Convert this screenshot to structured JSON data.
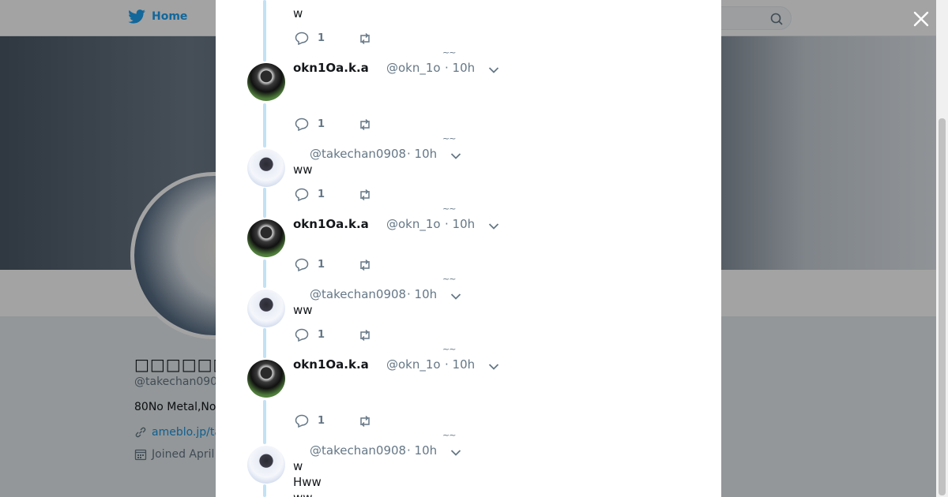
{
  "nav": {
    "home_label": "Home"
  },
  "profile": {
    "name": "□□□□□□□□□□",
    "handle": "@takechan090",
    "bio": "80No Metal,No",
    "url": "ameblo.jp/ta",
    "joined": "Joined April"
  },
  "thread": {
    "top_text": "w",
    "top_reply_count": "1",
    "tweets": [
      {
        "display_name": "okn1Oa.k.a",
        "handle": "@okn_1o",
        "time": "· 10h",
        "text": "",
        "reply_count": "1"
      },
      {
        "display_name": "",
        "handle": "@takechan0908",
        "time": "· 10h",
        "text": "ww",
        "reply_count": "1"
      },
      {
        "display_name": "okn1Oa.k.a",
        "handle": "@okn_1o",
        "time": "· 10h",
        "text": "",
        "reply_count": "1"
      },
      {
        "display_name": "",
        "handle": "@takechan0908",
        "time": "· 10h",
        "text": "ww",
        "reply_count": "1"
      },
      {
        "display_name": "okn1Oa.k.a",
        "handle": "@okn_1o",
        "time": "· 10h",
        "text": "",
        "reply_count": "1"
      },
      {
        "display_name": "",
        "handle": "@takechan0908",
        "time": "· 10h",
        "text_lines": [
          "w",
          "Hww",
          "ww"
        ]
      }
    ],
    "tilde": "~~"
  },
  "colors": {
    "accent": "#1da1f2",
    "thread_line": "#c4e1f5",
    "muted": "#657786"
  }
}
